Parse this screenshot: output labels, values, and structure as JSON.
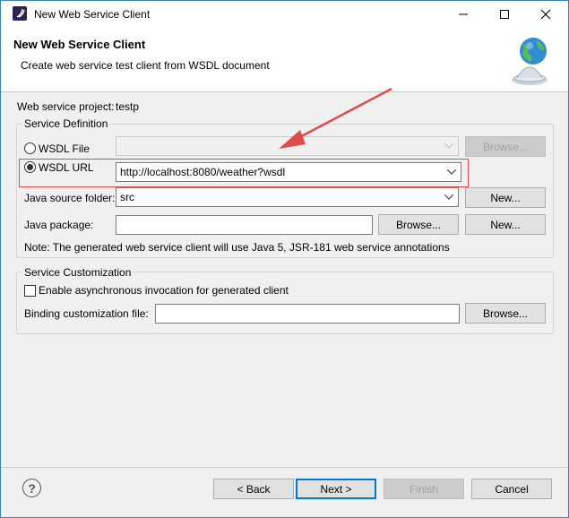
{
  "window": {
    "title": "New Web Service Client",
    "buttons": {
      "minimize": "—",
      "maximize": "☐",
      "close": "✕"
    }
  },
  "banner": {
    "title": "New Web Service Client",
    "description": "Create web service test client from WSDL document"
  },
  "project": {
    "label": "Web service project:",
    "value": "testp"
  },
  "service_definition": {
    "group_label": "Service Definition",
    "wsdl_file": {
      "label": "WSDL File",
      "selected": false,
      "value": "",
      "browse_label": "Browse..."
    },
    "wsdl_url": {
      "label": "WSDL URL",
      "selected": true,
      "value": "http://localhost:8080/weather?wsdl"
    },
    "java_source_folder": {
      "label": "Java source folder:",
      "value": "src",
      "new_label": "New..."
    },
    "java_package": {
      "label": "Java package:",
      "value": "",
      "browse_label": "Browse...",
      "new_label": "New..."
    },
    "note": "Note: The generated web service client will use Java 5, JSR-181 web service annotations"
  },
  "service_customization": {
    "group_label": "Service Customization",
    "async": {
      "label": "Enable asynchronous invocation for generated client",
      "checked": false
    },
    "binding": {
      "label": "Binding customization file:",
      "value": "",
      "browse_label": "Browse..."
    }
  },
  "footer": {
    "help_label": "?",
    "back_label": "< Back",
    "next_label": "Next >",
    "finish_label": "Finish",
    "cancel_label": "Cancel"
  },
  "colors": {
    "accent": "#0078d7",
    "annotation": "#e04b4b"
  }
}
